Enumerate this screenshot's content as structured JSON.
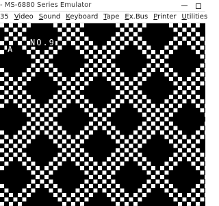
{
  "window": {
    "title": "- MS-6880 Series Emulator"
  },
  "menu": [
    {
      "prefix": "",
      "accel": "",
      "rest": "35",
      "name": "menu-item-35"
    },
    {
      "prefix": "",
      "accel": "V",
      "rest": "ideo",
      "name": "menu-item-video"
    },
    {
      "prefix": "",
      "accel": "S",
      "rest": "ound",
      "name": "menu-item-sound"
    },
    {
      "prefix": "",
      "accel": "K",
      "rest": "eyboard",
      "name": "menu-item-keyboard"
    },
    {
      "prefix": "",
      "accel": "T",
      "rest": "ape",
      "name": "menu-item-tape"
    },
    {
      "prefix": "",
      "accel": "E",
      "rest": "x.Bus",
      "name": "menu-item-exbus"
    },
    {
      "prefix": "",
      "accel": "P",
      "rest": "rinter",
      "name": "menu-item-printer"
    },
    {
      "prefix": "",
      "accel": "U",
      "rest": "tilities",
      "name": "menu-item-utilities"
    }
  ],
  "screen": {
    "caption": "NO.9",
    "cursor_char": "A",
    "background": "#000000",
    "foreground": "#ffffff"
  }
}
